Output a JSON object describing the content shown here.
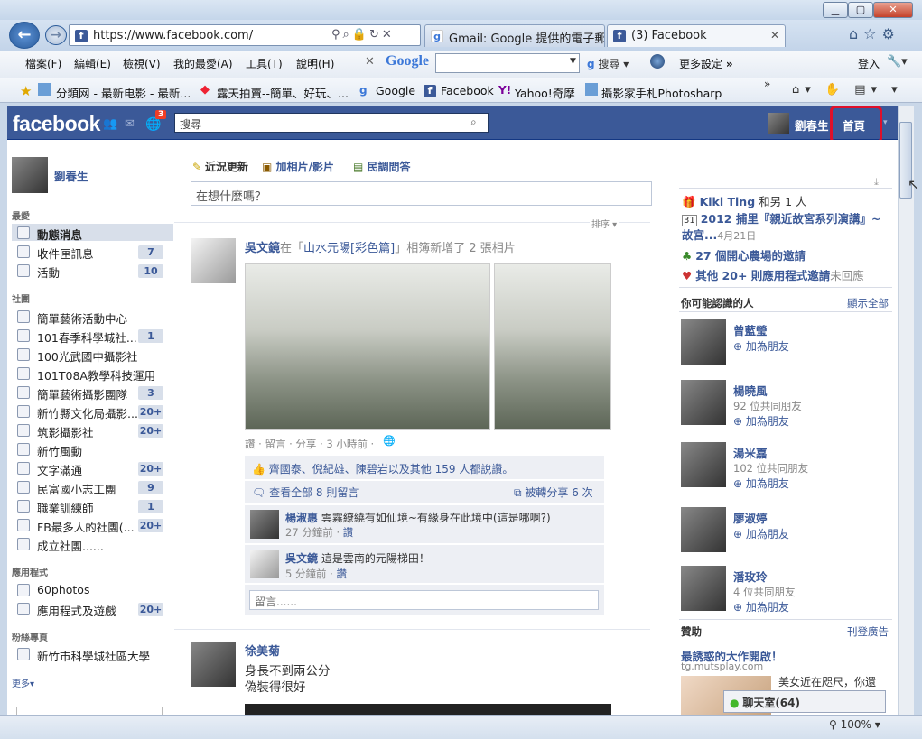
{
  "browser": {
    "url": "https://www.facebook.com/",
    "tabs": [
      {
        "label": "Gmail: Google 提供的電子郵..."
      },
      {
        "label": "(3) Facebook"
      }
    ],
    "window_buttons": {
      "minimize": "▁",
      "maximize": "▢",
      "close": "✕"
    },
    "menu": [
      "檔案(F)",
      "編輯(E)",
      "檢視(V)",
      "我的最愛(A)",
      "工具(T)",
      "說明(H)"
    ],
    "google_label": "Google",
    "search_label": "搜尋",
    "more_settings": "更多設定",
    "login": "登入",
    "favorites": [
      "分類网 - 最新电影 - 最新...",
      "露天拍賣--簡單、好玩、...",
      "Google",
      "Facebook",
      "Yahoo!奇摩",
      "攝影家手札Photosharp"
    ],
    "zoom": "100%",
    "chevrons": "»"
  },
  "fb": {
    "logo": "facebook",
    "notif_count": "3",
    "search_placeholder": "搜尋",
    "user_name": "劉春生",
    "home": "首頁",
    "left": {
      "profile_name": "劉春生",
      "section_favorites": "最愛",
      "favorites": [
        {
          "label": "動態消息",
          "count": ""
        },
        {
          "label": "收件匣訊息",
          "count": "7"
        },
        {
          "label": "活動",
          "count": "10"
        }
      ],
      "section_groups": "社團",
      "groups": [
        {
          "label": "簡單藝術活動中心",
          "count": ""
        },
        {
          "label": "101春季科學城社...",
          "count": "1"
        },
        {
          "label": "100光武國中攝影社",
          "count": ""
        },
        {
          "label": "101T08A教學科技運用",
          "count": ""
        },
        {
          "label": "簡單藝術攝影團隊",
          "count": "3"
        },
        {
          "label": "新竹縣文化局攝影...",
          "count": "20+"
        },
        {
          "label": "筑影攝影社",
          "count": "20+"
        },
        {
          "label": "新竹風動",
          "count": ""
        },
        {
          "label": "文字滿通",
          "count": "20+"
        },
        {
          "label": "民富國小志工團",
          "count": "9"
        },
        {
          "label": "職業訓練師",
          "count": "1"
        },
        {
          "label": "FB最多人的社團(...",
          "count": "20+"
        },
        {
          "label": "成立社團......",
          "count": ""
        }
      ],
      "section_apps": "應用程式",
      "apps": [
        {
          "label": "60photos",
          "count": ""
        },
        {
          "label": "應用程式及遊戲",
          "count": "20+"
        }
      ],
      "section_pages": "粉絲專頁",
      "pages": [
        {
          "label": "新竹市科學城社區大學",
          "count": ""
        }
      ],
      "more": "更多▾"
    },
    "composer": {
      "tab_status": "近況更新",
      "tab_photo": "加相片/影片",
      "tab_poll": "民調問答",
      "placeholder": "在想什麼嗎？",
      "sort": "排序 ▾"
    },
    "post1": {
      "author": "吳文鏡",
      "text_pre": "在「",
      "album": "山水元陽[彩色篇]",
      "text_post": "」相簿新增了 2 張相片",
      "actions": "讚 · 留言 · 分享 · 3 小時前 ·",
      "likes": "齊國泰、倪紀雄、陳碧岩以及其他 159 人都說讚。",
      "view_all": "查看全部 8 則留言",
      "shares": "被轉分享 6 次",
      "comments": [
        {
          "name": "楊淑惠",
          "text": "雲霧繚繞有如仙境~有緣身在此境中(這是哪啊?)",
          "meta": "27 分鐘前 ·",
          "like": "讚"
        },
        {
          "name": "吳文鏡",
          "text": "這是雲南的元陽梯田！",
          "meta": "5 分鐘前 ·",
          "like": "讚"
        }
      ],
      "comment_placeholder": "留言......"
    },
    "post2": {
      "author": "徐美菊",
      "line1": "身長不到兩公分",
      "line2": "偽裝得很好"
    },
    "right": {
      "birthday": "Kiki Ting",
      "birthday_more": "和另 1 人",
      "event": "2012 捕里『親近故宮系列演講』~故宮...",
      "event_date": "4月21日",
      "farm": "27 個開心農場的邀請",
      "apps_invite": "其他 20+ 則應用程式邀請",
      "apps_ignore": "未回應",
      "pymk_title": "你可能認識的人",
      "pymk_all": "顯示全部",
      "people": [
        {
          "name": "曾藍瑩",
          "mutual": "",
          "add": "加為朋友"
        },
        {
          "name": "楊曉風",
          "mutual": "92 位共同朋友",
          "add": "加為朋友"
        },
        {
          "name": "湯米嘉",
          "mutual": "102 位共同朋友",
          "add": "加為朋友"
        },
        {
          "name": "廖淑婷",
          "mutual": "",
          "add": "加為朋友"
        },
        {
          "name": "潘玫玲",
          "mutual": "4 位共同朋友",
          "add": "加為朋友"
        }
      ],
      "sponsor_title": "贊助",
      "sponsor_ad": "刊登廣告",
      "ad_title": "最誘惑的大作開啟！",
      "ad_url": "tg.mutsplay.com",
      "ad_text": "美女近在咫尺，你還",
      "chat": "聊天室(64)"
    }
  }
}
